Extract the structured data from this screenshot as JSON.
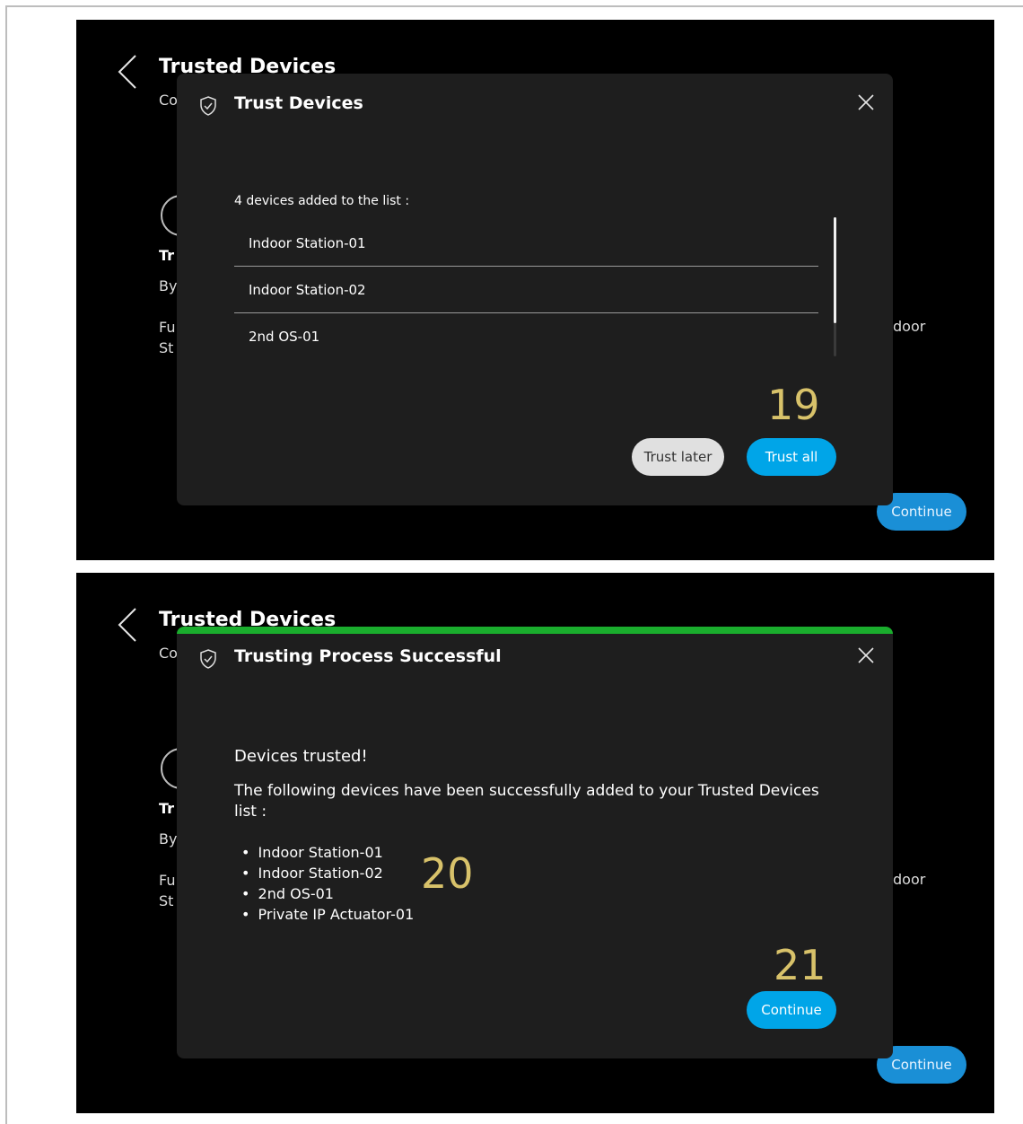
{
  "background_page": {
    "title": "Trusted Devices",
    "subtitle_fragment": "Co",
    "item_fragment": "Tr",
    "by_fragment": "By",
    "fu_fragment": "Fu",
    "st_fragment": "St",
    "door_fragment": "door",
    "continue_label": "Continue"
  },
  "dialog_trust": {
    "title": "Trust Devices",
    "list_caption": "4 devices added to the list :",
    "devices": [
      "Indoor Station-01",
      "Indoor Station-02",
      "2nd OS-01"
    ],
    "trust_later_label": "Trust later",
    "trust_all_label": "Trust all",
    "step_number": "19"
  },
  "dialog_success": {
    "title": "Trusting Process Successful",
    "heading": "Devices trusted!",
    "body": "The following devices have been successfully added to your Trusted Devices list :",
    "devices": [
      "Indoor Station-01",
      "Indoor Station-02",
      "2nd OS-01",
      "Private IP Actuator-01"
    ],
    "continue_label": "Continue",
    "step_number_list": "20",
    "step_number_button": "21"
  },
  "icons": {
    "back": "chevron-left-icon",
    "shield": "shield-check-icon",
    "close": "close-icon"
  },
  "colors": {
    "accent_blue": "#00a5e8",
    "success_green": "#1aad2d",
    "step_number": "#d8c26a"
  }
}
